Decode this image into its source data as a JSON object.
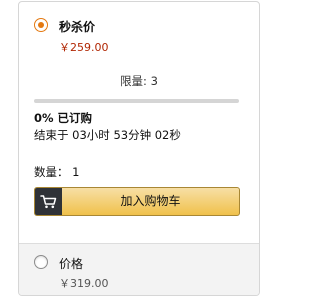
{
  "flash_sale": {
    "title": "秒杀价",
    "price": "￥259.00",
    "limit_text": "限量: 3",
    "progress": 0.0,
    "sold_text": "0% 已订购",
    "ends_text": "结束于 03小时 53分钟 02秒",
    "quantity_text": "数量： 1",
    "add_to_cart_label": "加入购物车"
  },
  "regular": {
    "title": "价格",
    "price": "￥319.00"
  },
  "colors": {
    "accent": "#e47911",
    "price_red": "#b12704",
    "button_yellow": "#f0c14b"
  },
  "icons": {
    "cart": "shopping-cart-icon"
  }
}
